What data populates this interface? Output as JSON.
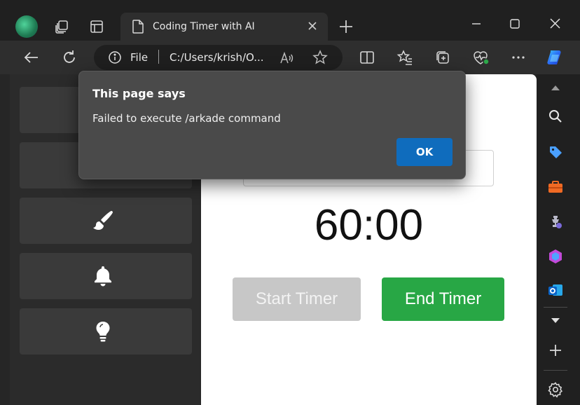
{
  "browser": {
    "tab_title": "Coding Timer with AI",
    "address_scheme": "File",
    "address_url": "C:/Users/krish/O..."
  },
  "sidebar_cards": [
    {
      "icon": "hidden-icon"
    },
    {
      "icon": "hidden-icon"
    },
    {
      "icon": "paintbrush-icon"
    },
    {
      "icon": "bell-icon"
    },
    {
      "icon": "lightbulb-icon"
    }
  ],
  "main": {
    "timer_display": "60:00",
    "start_button_label": "Start Timer",
    "end_button_label": "End Timer"
  },
  "dialog": {
    "title": "This page says",
    "message": "Failed to execute /arkade command",
    "ok_label": "OK"
  },
  "colors": {
    "end_button": "#28a745",
    "start_button_disabled": "#c7c7c7",
    "ok_button": "#0f6cbd",
    "browser_chrome": "#202020"
  }
}
